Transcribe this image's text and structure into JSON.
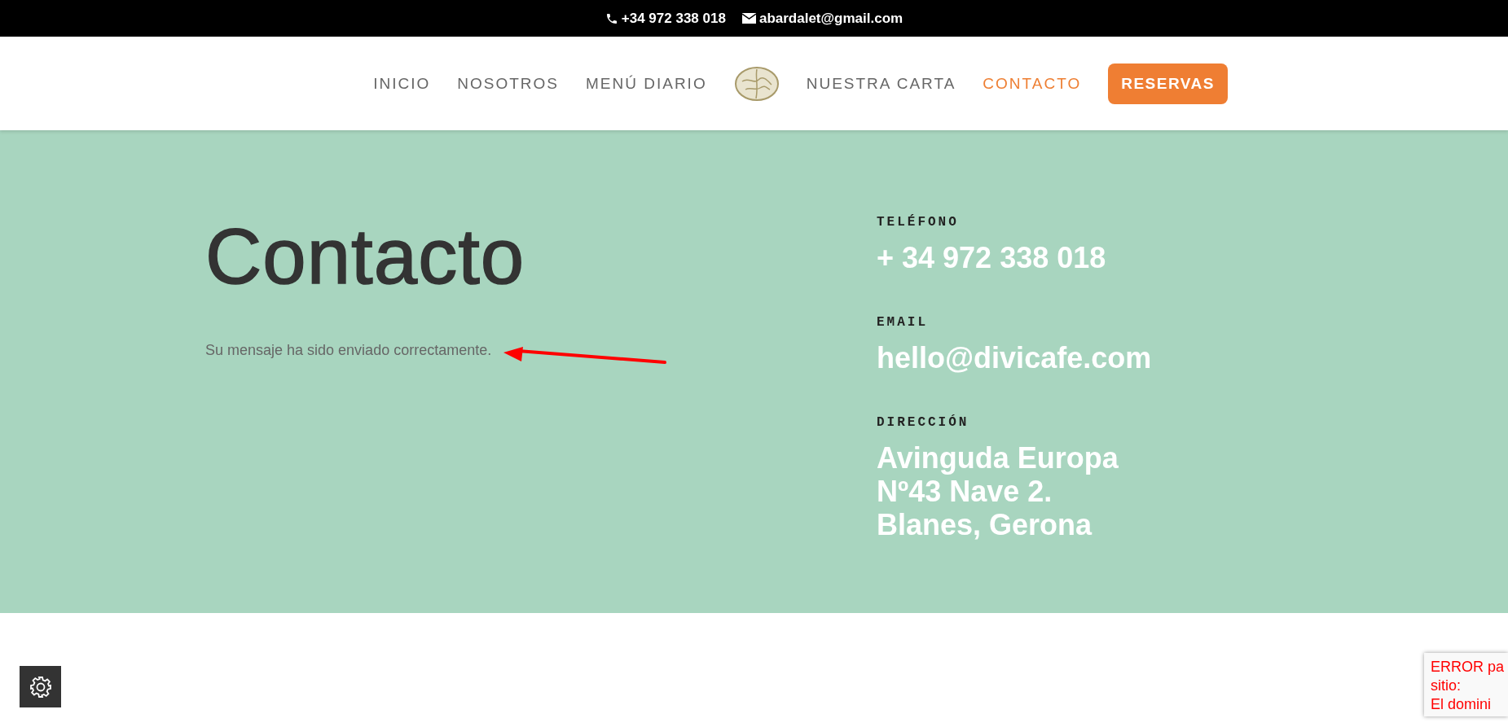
{
  "top_bar": {
    "phone": "+34 972 338 018",
    "email": "abardalet@gmail.com"
  },
  "nav": {
    "items": [
      {
        "label": "INICIO",
        "selected": false
      },
      {
        "label": "NOSOTROS",
        "selected": false
      },
      {
        "label": "MENÚ DIARIO",
        "selected": false
      },
      {
        "kind": "logo"
      },
      {
        "label": "NUESTRA CARTA",
        "selected": false
      },
      {
        "label": "CONTACTO",
        "selected": true
      }
    ],
    "button": "RESERVAS"
  },
  "hero": {
    "title": "Contacto",
    "message": "Su mensaje ha sido enviado correctamente."
  },
  "contact_info": [
    {
      "label": "TELÉFONO",
      "lines": [
        "+ 34 972 338 018"
      ]
    },
    {
      "label": "EMAIL",
      "lines": [
        "hello@divicafe.com"
      ]
    },
    {
      "label": "DIRECCIÓN",
      "lines": [
        "Avinguda Europa",
        "Nº43 Nave 2.",
        "Blanes, Gerona"
      ]
    }
  ],
  "error_box": {
    "lines": [
      "ERROR pa",
      "sitio:",
      "El domini"
    ]
  }
}
